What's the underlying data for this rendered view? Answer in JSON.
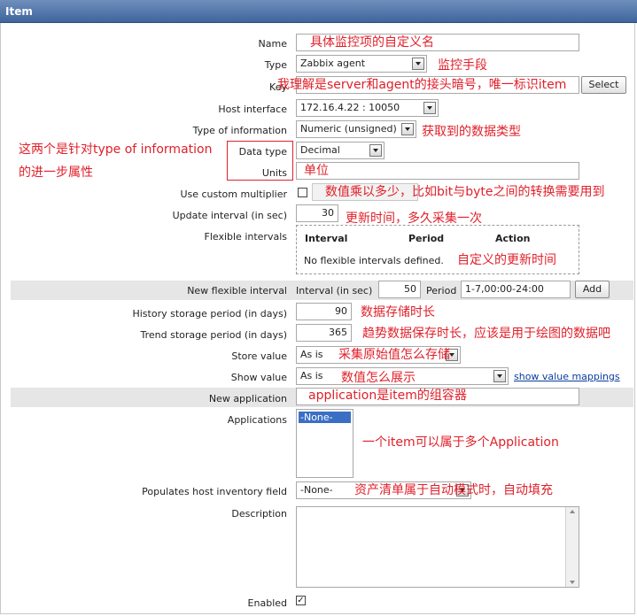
{
  "form_title": "Item",
  "labels": {
    "name": "Name",
    "type": "Type",
    "key": "Key",
    "host_interface": "Host interface",
    "type_of_information": "Type of information",
    "data_type": "Data type",
    "units": "Units",
    "use_custom_multiplier": "Use custom multiplier",
    "update_interval": "Update interval (in sec)",
    "flexible_intervals": "Flexible intervals",
    "new_flexible_interval": "New flexible interval",
    "history_storage": "History storage period (in days)",
    "trend_storage": "Trend storage period (in days)",
    "store_value": "Store value",
    "show_value": "Show value",
    "new_application": "New application",
    "applications": "Applications",
    "populates_inventory": "Populates host inventory field",
    "description": "Description",
    "enabled": "Enabled"
  },
  "fields": {
    "type": "Zabbix agent",
    "host_interface": "172.16.4.22 : 10050",
    "type_of_information": "Numeric (unsigned)",
    "data_type": "Decimal",
    "update_interval": "30",
    "history_storage": "90",
    "trend_storage": "365",
    "store_value": "As is",
    "show_value": "As is",
    "applications_option": "-None-",
    "inventory_field": "-None-",
    "enabled_mark": "✓"
  },
  "buttons": {
    "select": "Select",
    "add": "Add"
  },
  "flexible_table": {
    "headers": [
      "Interval",
      "Period",
      "Action"
    ],
    "empty_text": "No flexible intervals defined."
  },
  "new_interval": {
    "interval_label": "Interval (in sec)",
    "interval_value": "50",
    "period_label": "Period",
    "period_value": "1-7,00:00-24:00"
  },
  "links": {
    "show_value_mappings": "show value mappings"
  },
  "annotations": {
    "name": "具体监控项的自定义名",
    "type": "监控手段",
    "key": "我理解是server和agent的接头暗号，唯一标识item",
    "type_of_information": "获取到的数据类型",
    "data_type_line1": "这两个是针对type of information",
    "data_type_line2": "的进一步属性",
    "units": "单位",
    "multiplier": "数值乘以多少，比如bit与byte之间的转换需要用到",
    "update_interval": "更新时间，多久采集一次",
    "flexible": "自定义的更新时间",
    "history": "数据存储时长",
    "trend": "趋势数据保存时长，应该是用于绘图的数据吧",
    "store_value": "采集原始值怎么存储",
    "show_value": "数值怎么展示",
    "new_application": "application是item的组容器",
    "applications": "一个item可以属于多个Application",
    "inventory": "资产清单属于自动模式时，自动填充"
  },
  "colors": {
    "header_bg": "#4d72a8",
    "annotation": "#e0202a",
    "band": "#e6e6e6",
    "link": "#0b3c9c"
  }
}
